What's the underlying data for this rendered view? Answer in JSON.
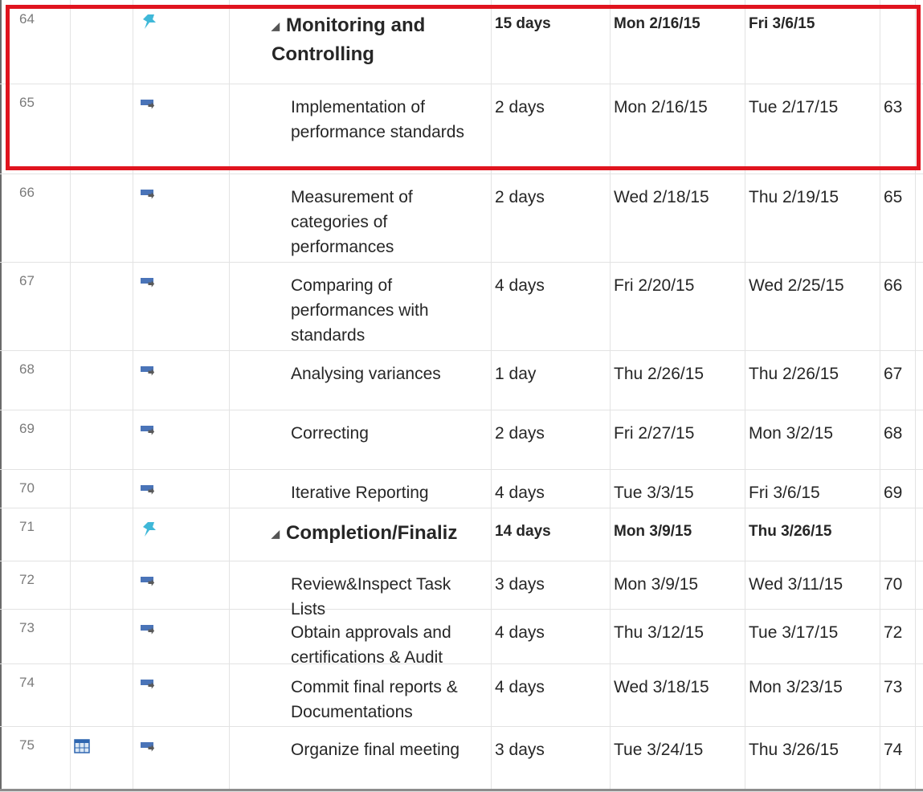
{
  "rows": [
    {
      "id": "64",
      "info_icon": "",
      "mode_icon": "pin-icon",
      "name": "Monitoring and Controlling",
      "summary": true,
      "duration": "15 days",
      "start": "Mon 2/16/15",
      "finish": "Fri 3/6/15",
      "predecessors": ""
    },
    {
      "id": "65",
      "info_icon": "",
      "mode_icon": "auto-schedule-icon",
      "name": "Implementation of performance standards",
      "summary": false,
      "duration": "2 days",
      "start": "Mon 2/16/15",
      "finish": "Tue 2/17/15",
      "predecessors": "63"
    },
    {
      "id": "66",
      "info_icon": "",
      "mode_icon": "auto-schedule-icon",
      "name": "Measurement of categories of performances",
      "summary": false,
      "duration": "2 days",
      "start": "Wed 2/18/15",
      "finish": "Thu 2/19/15",
      "predecessors": "65"
    },
    {
      "id": "67",
      "info_icon": "",
      "mode_icon": "auto-schedule-icon",
      "name": "Comparing of performances with standards",
      "summary": false,
      "duration": "4 days",
      "start": "Fri 2/20/15",
      "finish": "Wed 2/25/15",
      "predecessors": "66"
    },
    {
      "id": "68",
      "info_icon": "",
      "mode_icon": "auto-schedule-icon",
      "name": "Analysing variances",
      "summary": false,
      "duration": "1 day",
      "start": "Thu 2/26/15",
      "finish": "Thu 2/26/15",
      "predecessors": "67"
    },
    {
      "id": "69",
      "info_icon": "",
      "mode_icon": "auto-schedule-icon",
      "name": "Correcting",
      "summary": false,
      "duration": "2 days",
      "start": "Fri 2/27/15",
      "finish": "Mon 3/2/15",
      "predecessors": "68"
    },
    {
      "id": "70",
      "info_icon": "",
      "mode_icon": "auto-schedule-icon",
      "name": "Iterative Reporting",
      "summary": false,
      "duration": "4 days",
      "start": "Tue 3/3/15",
      "finish": "Fri 3/6/15",
      "predecessors": "69"
    },
    {
      "id": "71",
      "info_icon": "",
      "mode_icon": "pin-icon",
      "name": "Completion/Finaliz",
      "summary": true,
      "duration": "14 days",
      "start": "Mon 3/9/15",
      "finish": "Thu 3/26/15",
      "predecessors": ""
    },
    {
      "id": "72",
      "info_icon": "",
      "mode_icon": "auto-schedule-icon",
      "name": "Review&Inspect Task Lists",
      "summary": false,
      "duration": "3 days",
      "start": "Mon 3/9/15",
      "finish": "Wed 3/11/15",
      "predecessors": "70"
    },
    {
      "id": "73",
      "info_icon": "",
      "mode_icon": "auto-schedule-icon",
      "name": "Obtain approvals and certifications & Audit",
      "summary": false,
      "duration": "4 days",
      "start": "Thu 3/12/15",
      "finish": "Tue 3/17/15",
      "predecessors": "72"
    },
    {
      "id": "74",
      "info_icon": "",
      "mode_icon": "auto-schedule-icon",
      "name": "Commit final reports & Documentations",
      "summary": false,
      "duration": "4 days",
      "start": "Wed 3/18/15",
      "finish": "Mon 3/23/15",
      "predecessors": "73"
    },
    {
      "id": "75",
      "info_icon": "calendar-icon",
      "mode_icon": "auto-schedule-icon",
      "name": "Organize final meeting",
      "summary": false,
      "duration": "3 days",
      "start": "Tue 3/24/15",
      "finish": "Thu 3/26/15",
      "predecessors": "74"
    }
  ],
  "highlight_color": "#e0141e",
  "pin_color": "#3fb8d8",
  "task_icon_color": "#4a74b8"
}
